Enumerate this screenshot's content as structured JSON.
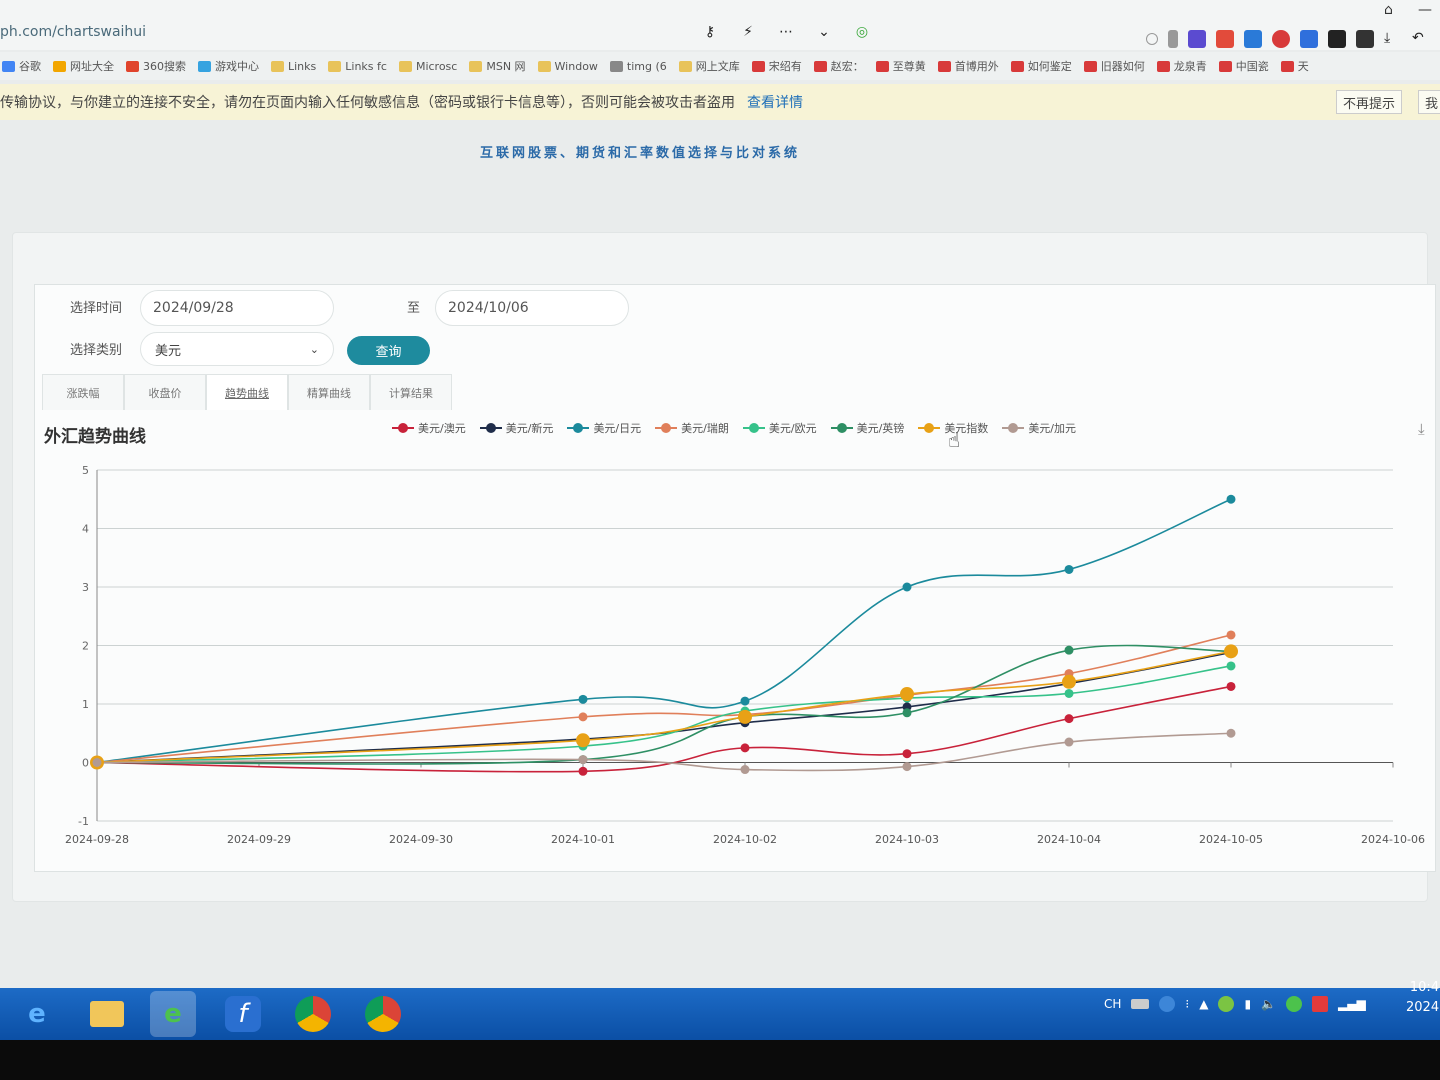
{
  "browser": {
    "url": "ph.com/chartswaihui",
    "bookmarks": [
      "谷歌",
      "网址大全",
      "360搜索",
      "游戏中心",
      "Links",
      "Links fc",
      "Microsc",
      "MSN 网",
      "Window",
      "timg (6",
      "网上文库",
      "宋绍有",
      "赵宏：",
      "至尊黄",
      "首博用外",
      "如何鉴定",
      "旧器如何",
      "龙泉青",
      "中国瓷",
      "天"
    ],
    "warning_text": "传输协议，与你建立的连接不安全，请勿在页面内输入任何敏感信息（密码或银行卡信息等），否则可能会被攻击者盗用",
    "warning_link": "查看详情",
    "warning_dismiss": "不再提示",
    "warning_more": "我"
  },
  "page": {
    "title": "互联网股票、期货和汇率数值选择与比对系统"
  },
  "form": {
    "time_label": "选择时间",
    "start_date": "2024/09/28",
    "to_label": "至",
    "end_date": "2024/10/06",
    "category_label": "选择类别",
    "category_value": "美元",
    "query_button": "查询"
  },
  "tabs": [
    "涨跌幅",
    "收盘价",
    "趋势曲线",
    "精算曲线",
    "计算结果"
  ],
  "active_tab": 2,
  "chart_data": {
    "type": "line",
    "title": "外汇趋势曲线",
    "x": [
      "2024-09-28",
      "2024-09-29",
      "2024-09-30",
      "2024-10-01",
      "2024-10-02",
      "2024-10-03",
      "2024-10-04",
      "2024-10-05",
      "2024-10-06"
    ],
    "ylim": [
      -1,
      5
    ],
    "yticks": [
      -1,
      0,
      1,
      2,
      3,
      4,
      5
    ],
    "grid": true,
    "legend_position": "top",
    "series": [
      {
        "name": "美元/澳元",
        "color": "#c8223a",
        "values": [
          0,
          null,
          null,
          -0.15,
          0.25,
          0.15,
          0.75,
          1.3,
          null
        ]
      },
      {
        "name": "美元/新元",
        "color": "#1f2d4a",
        "values": [
          0,
          null,
          null,
          0.4,
          0.68,
          0.95,
          1.35,
          1.88,
          null
        ]
      },
      {
        "name": "美元/日元",
        "color": "#1b8a9c",
        "values": [
          0,
          null,
          null,
          1.08,
          1.05,
          3.0,
          3.3,
          4.5,
          null
        ]
      },
      {
        "name": "美元/瑞朗",
        "color": "#e07f5a",
        "values": [
          0,
          null,
          null,
          0.78,
          0.82,
          1.15,
          1.52,
          2.18,
          null
        ]
      },
      {
        "name": "美元/欧元",
        "color": "#36c28a",
        "values": [
          0,
          null,
          null,
          0.28,
          0.88,
          1.1,
          1.18,
          1.65,
          null
        ]
      },
      {
        "name": "美元/英镑",
        "color": "#2e8f64",
        "values": [
          0,
          null,
          null,
          0.05,
          0.78,
          0.85,
          1.92,
          1.9,
          null
        ]
      },
      {
        "name": "美元指数",
        "color": "#e8a116",
        "values": [
          0,
          null,
          null,
          0.38,
          0.78,
          1.17,
          1.38,
          1.9,
          null
        ]
      },
      {
        "name": "美元/加元",
        "color": "#b19a92",
        "values": [
          0,
          null,
          null,
          0.05,
          -0.12,
          -0.07,
          0.35,
          0.5,
          null
        ]
      }
    ]
  },
  "taskbar": {
    "tray_lang": "CH",
    "time": "10:4",
    "date": "2024"
  }
}
